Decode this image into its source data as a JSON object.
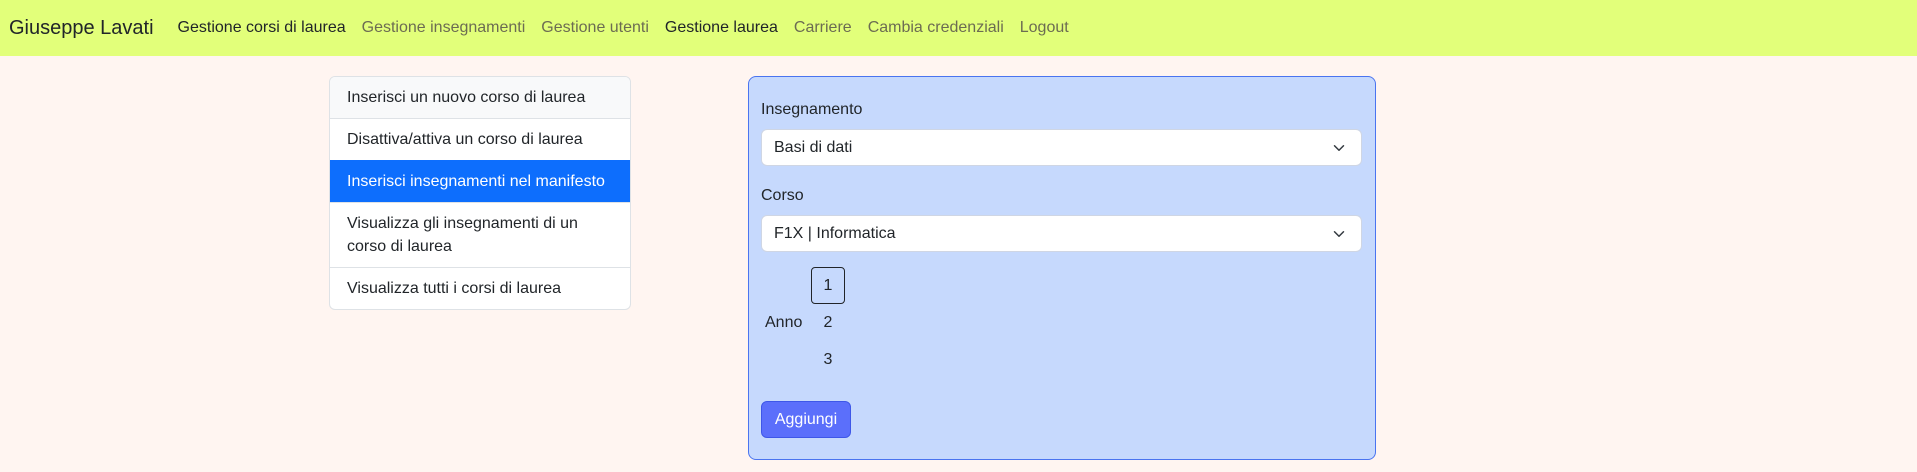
{
  "navbar": {
    "brand": "Giuseppe Lavati",
    "links": [
      {
        "label": "Gestione corsi di laurea",
        "active": true
      },
      {
        "label": "Gestione insegnamenti",
        "active": false
      },
      {
        "label": "Gestione utenti",
        "active": false
      },
      {
        "label": "Gestione laurea",
        "active": true
      },
      {
        "label": "Carriere",
        "active": false
      },
      {
        "label": "Cambia credenziali",
        "active": false
      },
      {
        "label": "Logout",
        "active": false
      }
    ]
  },
  "menu": {
    "items": [
      {
        "label": "Inserisci un nuovo corso di laurea"
      },
      {
        "label": "Disattiva/attiva un corso di laurea"
      },
      {
        "label": "Inserisci insegnamenti nel manifesto",
        "active": true
      },
      {
        "label": "Visualizza gli insegnamenti di un corso di laurea"
      },
      {
        "label": "Visualizza tutti i corsi di laurea"
      }
    ]
  },
  "form": {
    "insegnamento_label": "Insegnamento",
    "insegnamento_value": "Basi di dati",
    "corso_label": "Corso",
    "corso_value": "F1X | Informatica",
    "anno_label": "Anno",
    "anno_options": [
      "1",
      "2",
      "3"
    ],
    "anno_selected": "1",
    "submit_label": "Aggiungi"
  },
  "colors": {
    "navbar_bg": "#e2ff7a",
    "page_bg": "#fff5f1",
    "active_item": "#0d6efd",
    "form_bg": "#c6d9fd",
    "button_bg": "#5b6ffb"
  }
}
